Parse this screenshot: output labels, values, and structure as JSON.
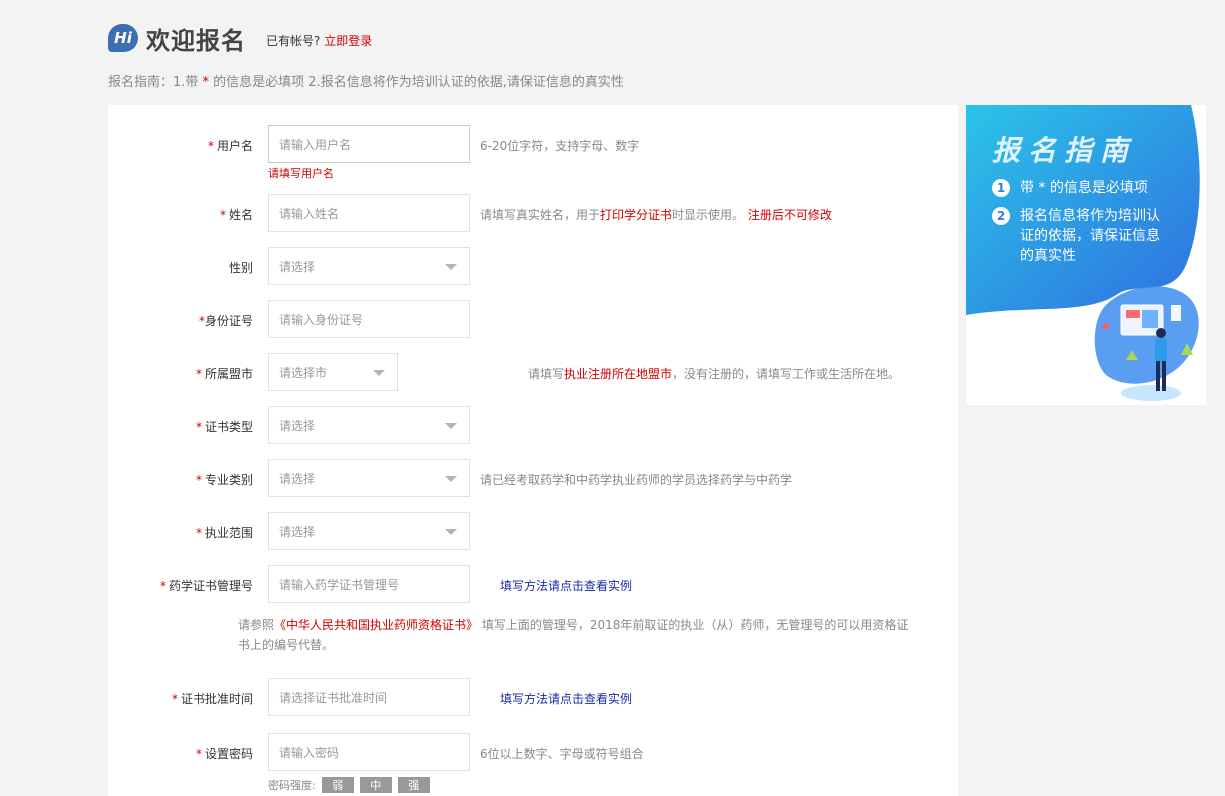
{
  "header": {
    "hi_badge": "Hi",
    "title": "欢迎报名",
    "has_account": "已有帐号?",
    "login_link": "立即登录"
  },
  "guide_line": {
    "prefix": "报名指南：1.带 ",
    "star": "*",
    "suffix": " 的信息是必填项 2.报名信息将作为培训认证的依据,请保证信息的真实性"
  },
  "form": {
    "required_mark": "*",
    "username": {
      "label": "用户名",
      "placeholder": "请输入用户名",
      "hint": "6-20位字符，支持字母、数字",
      "error": "请填写用户名"
    },
    "name": {
      "label": "姓名",
      "placeholder": "请输入姓名",
      "hint_prefix": "请填写真实姓名，用于",
      "hint_red1": "打印学分证书",
      "hint_mid": "时显示使用。 ",
      "hint_red2": "注册后不可修改"
    },
    "gender": {
      "label": "性别",
      "selected": "请选择"
    },
    "id_number": {
      "label": "身份证号",
      "placeholder": "请输入身份证号"
    },
    "city": {
      "label": "所属盟市",
      "selected": "请选择市",
      "hint_prefix": "请填写",
      "hint_red": "执业注册所在地盟市",
      "hint_suffix": "，没有注册的，请填写工作或生活所在地。"
    },
    "cert_type": {
      "label": "证书类型",
      "selected": "请选择"
    },
    "major": {
      "label": "专业类别",
      "selected": "请选择",
      "hint": "请已经考取药学和中药学执业药师的学员选择药学与中药学"
    },
    "practice_scope": {
      "label": "执业范围",
      "selected": "请选择"
    },
    "cert_number": {
      "label": "药学证书管理号",
      "placeholder": "请输入药学证书管理号",
      "link": "填写方法请点击查看实例"
    },
    "cert_note": {
      "prefix": "请参照",
      "red": "《中华人民共和国执业药师资格证书》",
      "suffix": " 填写上面的管理号，2018年前取证的执业（从）药师，无管理号的可以用资格证书上的编号代替。"
    },
    "approval_date": {
      "label": "证书批准时间",
      "placeholder": "请选择证书批准时间",
      "link": "填写方法请点击查看实例"
    },
    "password": {
      "label": "设置密码",
      "placeholder": "请输入密码",
      "hint": "6位以上数字、字母或符号组合"
    },
    "strength": {
      "label": "密码强度:",
      "weak": "弱",
      "medium": "中",
      "strong": "强"
    }
  },
  "side_card": {
    "title": "报名指南",
    "items": [
      {
        "num": "1",
        "text": "带 * 的信息是必填项"
      },
      {
        "num": "2",
        "text": "报名信息将作为培训认证的依据，请保证信息的真实性"
      }
    ]
  },
  "colors": {
    "accent_red": "#d40000",
    "link_blue": "#1a2aa8",
    "brand_blue": "#3c6fb2"
  }
}
